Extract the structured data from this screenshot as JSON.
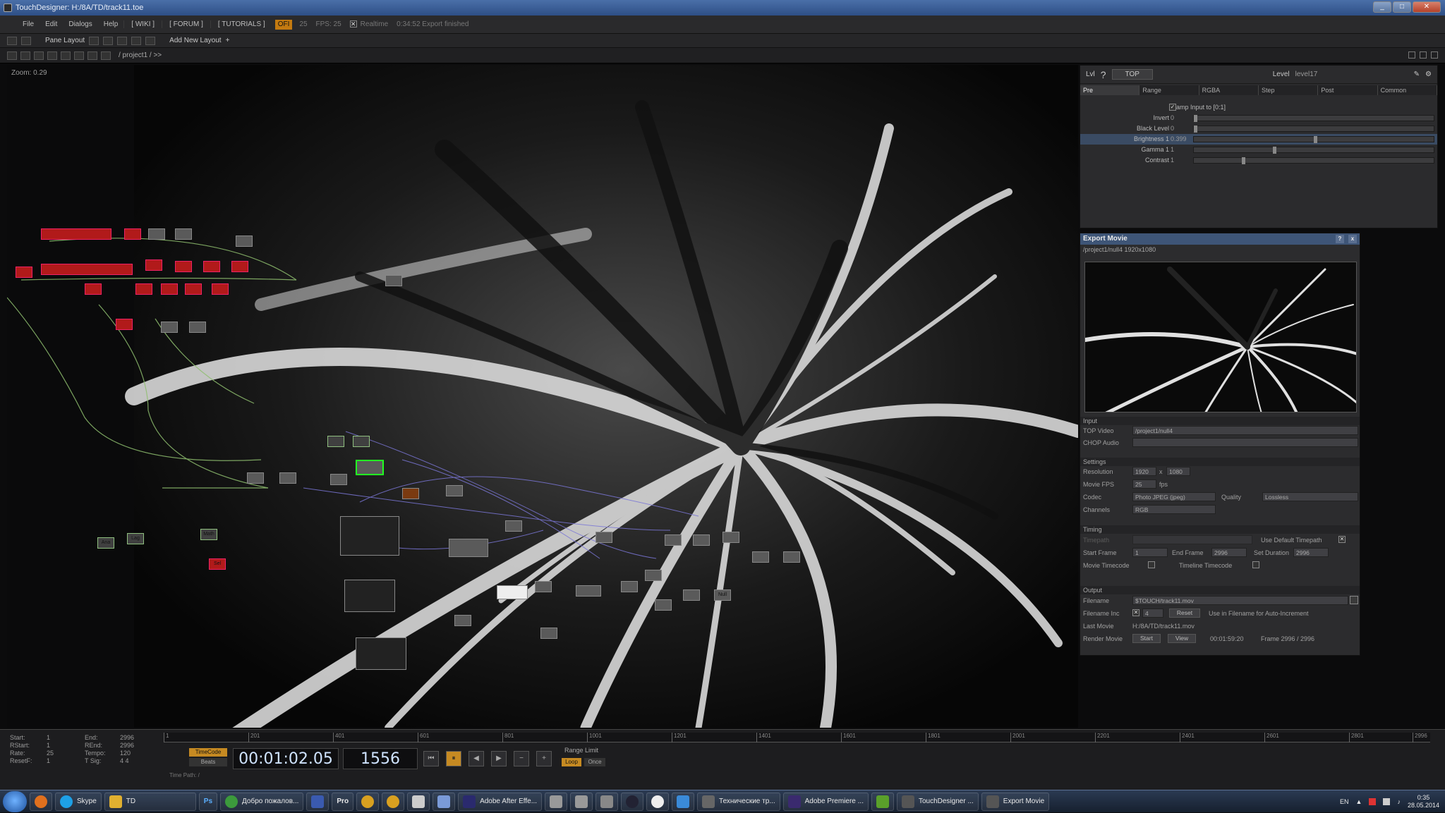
{
  "window": {
    "title": "TouchDesigner: H:/8A/TD/track11.toe"
  },
  "menu": {
    "items": [
      "File",
      "Edit",
      "Dialogs",
      "Help"
    ],
    "wiki": "[ WIKI ]",
    "forum": "[ FORUM ]",
    "tutorials": "[ TUTORIALS ]",
    "oi": "OFI",
    "fps_prefix": "25",
    "fps": "FPS: 25",
    "realtime": "Realtime",
    "status": "0:34:52 Export finished"
  },
  "toolbar": {
    "pane_layout": "Pane Layout",
    "add_layout": "Add New Layout",
    "add_plus": "+",
    "path": "/ project1 / >>"
  },
  "network": {
    "zoom": "Zoom: 0.29",
    "ops": {
      "ana": "Ana",
      "lag": "Lag",
      "math": "Math",
      "sel": "Sel",
      "null": "Null"
    }
  },
  "param": {
    "op_label": "Lvl",
    "op_type": "TOP",
    "level_label": "Level",
    "level_name": "level17",
    "tabs": [
      "Pre",
      "Range",
      "RGBA",
      "Step",
      "Post",
      "Common"
    ],
    "clamp_label": "Clamp Input to [0:1]",
    "rows": [
      {
        "label": "Invert",
        "value": "0",
        "pos": 0.0
      },
      {
        "label": "Black Level",
        "value": "0",
        "pos": 0.0
      },
      {
        "label": "Brightness 1",
        "value": "0.399",
        "pos": 0.5
      },
      {
        "label": "Gamma 1",
        "value": "1",
        "pos": 0.33
      },
      {
        "label": "Contrast",
        "value": "1",
        "pos": 0.2
      }
    ]
  },
  "export": {
    "title": "Export Movie",
    "subtitle": "/project1/null4 1920x1080",
    "help": "?",
    "close": "x",
    "input_section": "Input",
    "top_video_label": "TOP Video",
    "top_video": "/project1/null4",
    "chop_audio_label": "CHOP Audio",
    "settings_section": "Settings",
    "resolution_label": "Resolution",
    "res_w": "1920",
    "res_x": "x",
    "res_h": "1080",
    "fps_label": "Movie FPS",
    "fps": "25",
    "fps_unit": "fps",
    "codec_label": "Codec",
    "codec": "Photo JPEG (jpeg)",
    "quality_label": "Quality",
    "quality": "Lossless",
    "channels_label": "Channels",
    "channels": "RGB",
    "timing_section": "Timing",
    "timepath_label": "Timepath",
    "use_default": "Use Default Timepath",
    "start_label": "Start Frame",
    "start": "1",
    "end_label": "End Frame",
    "end": "2996",
    "setdur_label": "Set Duration",
    "setdur": "2996",
    "movie_tc": "Movie Timecode",
    "timeline_tc": "Timeline Timecode",
    "output_section": "Output",
    "filename_label": "Filename",
    "filename": "$TOUCH/track11.mov",
    "inc_label": "Filename Inc",
    "inc_val": "4",
    "reset": "Reset",
    "inc_note": "Use  in Filename for Auto-Increment",
    "last_label": "Last Movie",
    "last": "H:/8A/TD/track11.mov",
    "render_label": "Render Movie",
    "start_btn": "Start",
    "view_btn": "View",
    "elapsed": "00:01:59:20",
    "frame": "Frame  2996 / 2996"
  },
  "timeline": {
    "info": [
      [
        "Start:",
        "1",
        "End:",
        "2996"
      ],
      [
        "RStart:",
        "1",
        "REnd:",
        "2996"
      ],
      [
        "Rate:",
        "25",
        "Tempo:",
        "120"
      ],
      [
        "ResetF:",
        "1",
        "T Sig:",
        "4   4"
      ]
    ],
    "ticks": [
      "1",
      "201",
      "401",
      "601",
      "801",
      "1001",
      "1201",
      "1401",
      "1601",
      "1801",
      "2001",
      "2201",
      "2401",
      "2601",
      "2801",
      "2996"
    ],
    "timecode_btn": "TimeCode",
    "beats_btn": "Beats",
    "timecode": "00:01:02.05",
    "frame": "1556",
    "controls": [
      "⏮",
      "⏸",
      "◀",
      "▶",
      "−",
      "+"
    ],
    "range_limit": "Range Limit",
    "loop": "Loop",
    "once": "Once",
    "time_path": "Time Path: /"
  },
  "taskbar": {
    "items": [
      {
        "label": "Skype",
        "color": "#1ea0e6"
      },
      {
        "label": "TD",
        "color": "#e0b030"
      },
      {
        "label": "Добро пожалов...",
        "color": "#3c9a3c"
      },
      {
        "label": "Adobe After Effe...",
        "color": "#2a2a6e"
      },
      {
        "label": "Технические тр...",
        "color": "#666"
      },
      {
        "label": "Adobe Premiere ...",
        "color": "#3a2a6e"
      },
      {
        "label": "TouchDesigner ...",
        "color": "#555"
      },
      {
        "label": "Export Movie",
        "color": "#555"
      }
    ],
    "icons": [
      "Ps",
      "Pro"
    ],
    "lang": "EN",
    "time": "0:35",
    "date": "28.05.2014"
  }
}
